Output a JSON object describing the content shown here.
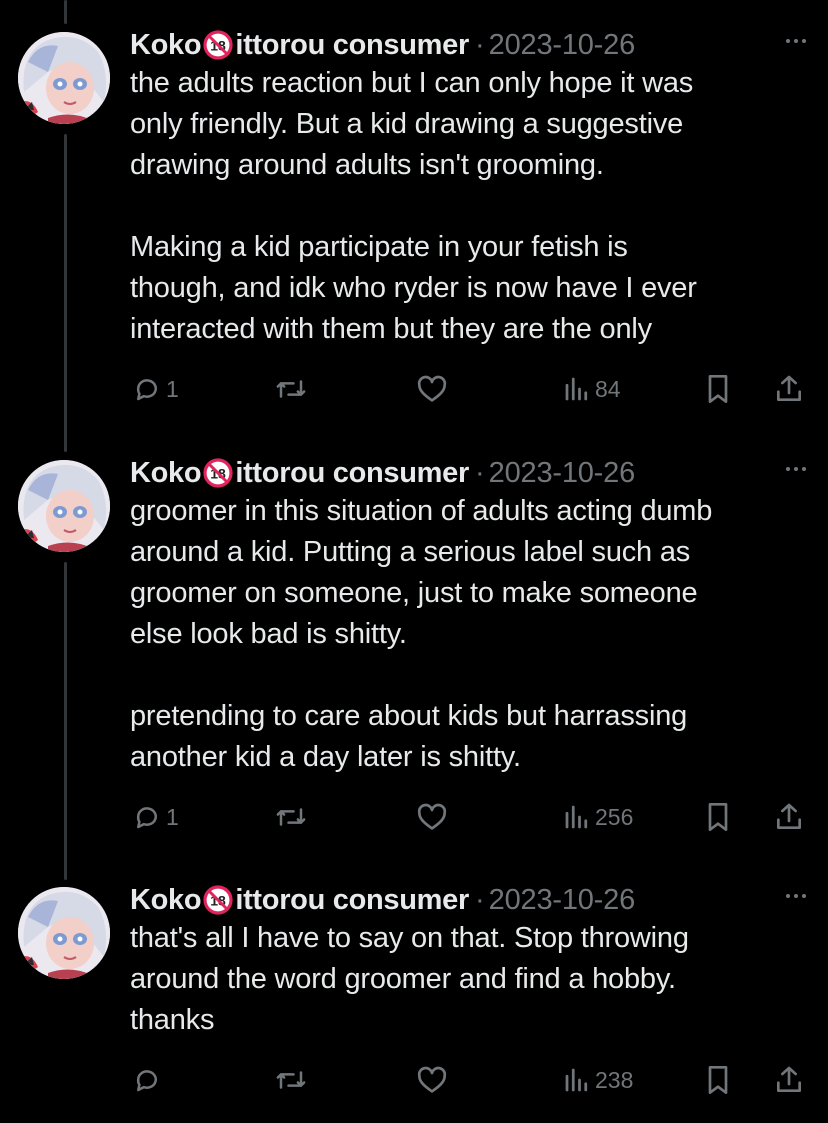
{
  "tweets": [
    {
      "author": "Koko",
      "author_suffix": "ittorou consumer",
      "badge_icon": "no-one-under-eighteen-emoji",
      "separator": "·",
      "date": "2023-10-26",
      "paragraphs": [
        "the adults reaction but I can only hope it was\nonly friendly. But a kid drawing a suggestive\ndrawing around adults isn't grooming.",
        "Making a kid participate in your fetish is\nthough, and idk who ryder is now have I ever\ninteracted with them but they are the only"
      ],
      "replies": "1",
      "views": "84"
    },
    {
      "author": "Koko",
      "author_suffix": "ittorou consumer",
      "badge_icon": "no-one-under-eighteen-emoji",
      "separator": "·",
      "date": "2023-10-26",
      "paragraphs": [
        "groomer in this situation of adults acting dumb\naround a kid. Putting a serious label such as\ngroomer on someone, just to make someone\nelse look bad is shitty.",
        "pretending to care about kids but harrassing\nanother kid a day later is shitty."
      ],
      "replies": "1",
      "views": "256"
    },
    {
      "author": "Koko",
      "author_suffix": "ittorou consumer",
      "badge_icon": "no-one-under-eighteen-emoji",
      "separator": "·",
      "date": "2023-10-26",
      "paragraphs": [
        "that's all I have to say on that. Stop throwing\naround the word groomer and find a hobby.\nthanks"
      ],
      "replies": "",
      "views": "238"
    }
  ],
  "colors": {
    "background": "#000000",
    "text_primary": "#e7e9ea",
    "text_secondary": "#71767b",
    "thread_line": "#333639",
    "emoji_red": "#e0245e"
  },
  "icons": [
    "reply-icon",
    "retweet-icon",
    "like-icon",
    "views-icon",
    "bookmark-icon",
    "share-icon",
    "more-icon"
  ]
}
